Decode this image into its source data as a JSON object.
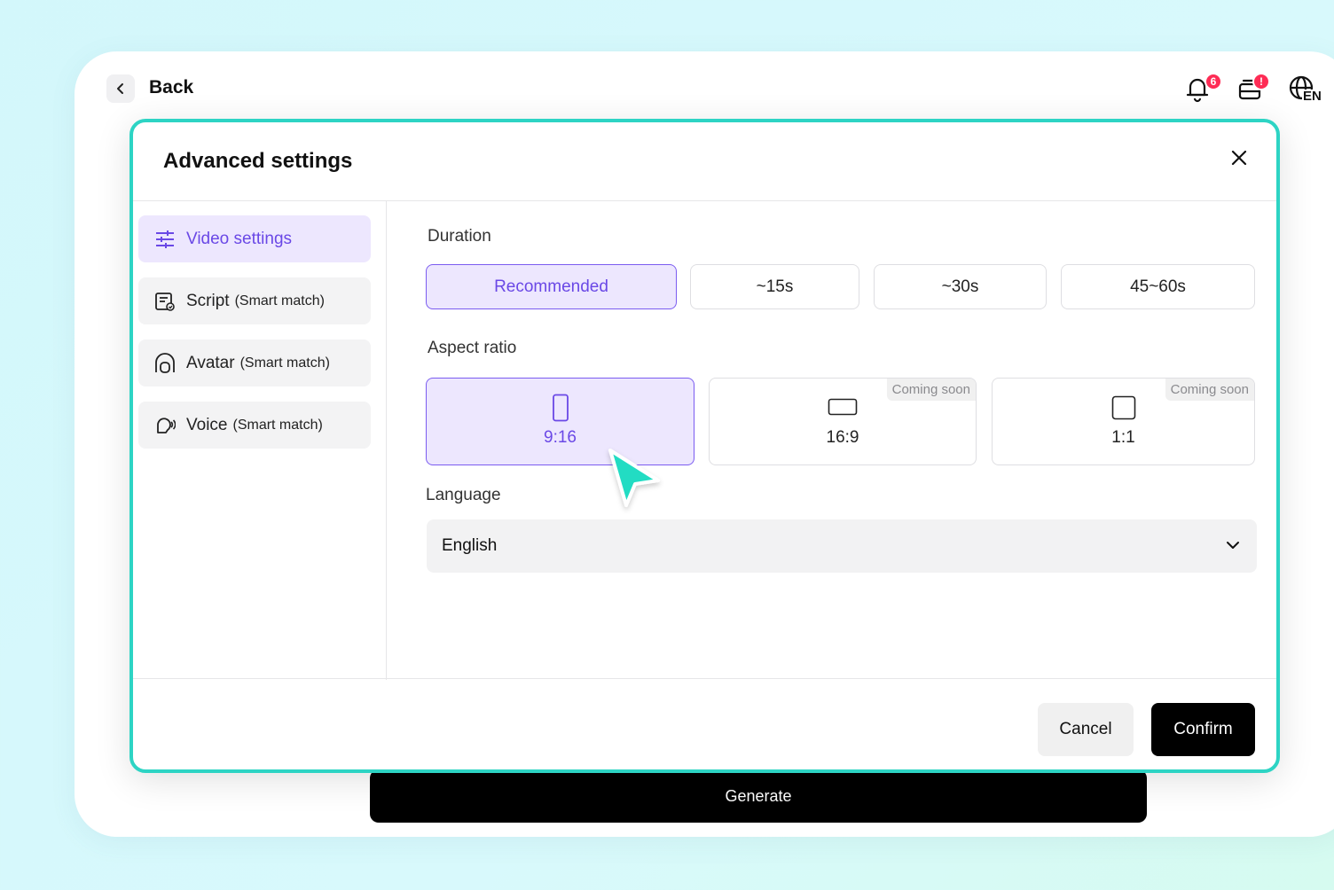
{
  "header": {
    "back_label": "Back",
    "notifications_badge": "6",
    "inbox_badge": "!",
    "language_code": "EN"
  },
  "generate_label": "Generate",
  "modal": {
    "title": "Advanced settings",
    "sidebar": {
      "items": [
        {
          "label": "Video settings",
          "sub": "",
          "active": true,
          "icon": "sliders-icon"
        },
        {
          "label": "Script",
          "sub": "(Smart match)",
          "active": false,
          "icon": "script-icon"
        },
        {
          "label": "Avatar",
          "sub": "(Smart match)",
          "active": false,
          "icon": "avatar-icon"
        },
        {
          "label": "Voice",
          "sub": "(Smart match)",
          "active": false,
          "icon": "voice-icon"
        }
      ]
    },
    "duration": {
      "label": "Duration",
      "options": [
        "Recommended",
        "~15s",
        "~30s",
        "45~60s"
      ],
      "selected": "Recommended"
    },
    "aspect_ratio": {
      "label": "Aspect ratio",
      "options": [
        {
          "label": "9:16",
          "badge": ""
        },
        {
          "label": "16:9",
          "badge": "Coming soon"
        },
        {
          "label": "1:1",
          "badge": "Coming soon"
        }
      ],
      "selected": "9:16"
    },
    "language": {
      "label": "Language",
      "value": "English"
    },
    "cancel_label": "Cancel",
    "confirm_label": "Confirm"
  },
  "colors": {
    "accent": "#6a48e6",
    "accent_bg": "#ede7fe",
    "modal_border": "#2dd4c4",
    "badge": "#fe2c55"
  }
}
